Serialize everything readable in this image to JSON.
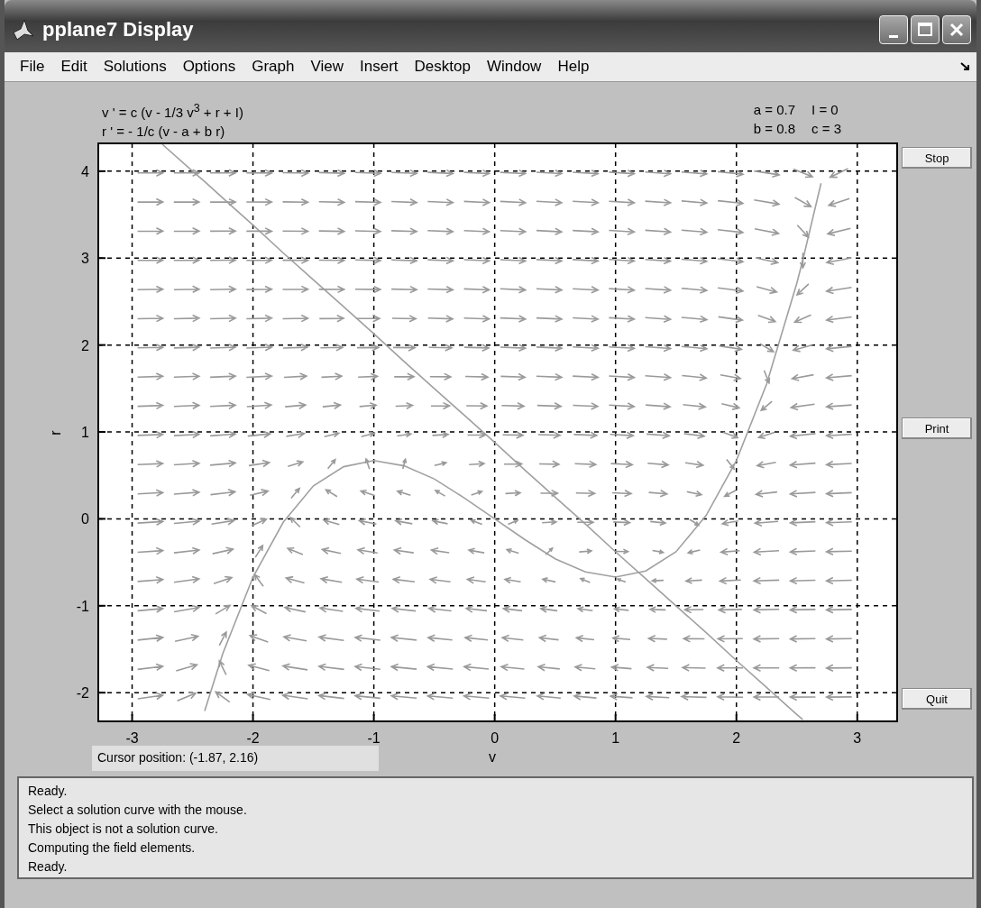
{
  "window": {
    "title": "pplane7 Display"
  },
  "menu": [
    "File",
    "Edit",
    "Solutions",
    "Options",
    "Graph",
    "View",
    "Insert",
    "Desktop",
    "Window",
    "Help"
  ],
  "equations": [
    "v ' = c (v - 1/3 v$^{3}$ + r + I)",
    "r ' = - 1/c (v - a + b r)"
  ],
  "parameters": [
    "a = 0.7",
    "I = 0",
    "b = 0.8",
    "c = 3"
  ],
  "plot": {
    "chart_data": {
      "type": "line",
      "xlabel": "v",
      "ylabel": "r",
      "x": [
        -2.75,
        -2.5,
        -2.4,
        -2.25,
        -2,
        -1.75,
        -1.5,
        -1.25,
        -1,
        -0.75,
        -0.5,
        -0.25,
        0,
        0.25,
        0.5,
        0.75,
        1,
        1.25,
        1.5,
        1.75,
        2,
        2.25,
        2.5,
        2.55,
        2.7
      ],
      "series": [
        {
          "color": "#a0a0a0",
          "values": [
            null,
            null,
            -2.21,
            -1.55,
            -0.67,
            -0.04,
            0.38,
            0.6,
            0.67,
            0.61,
            0.46,
            0.24,
            0,
            -0.24,
            -0.46,
            -0.61,
            -0.67,
            -0.6,
            -0.38,
            0.04,
            0.67,
            1.55,
            2.71,
            2.98,
            3.86
          ]
        },
        {
          "color": "#a0a0a0",
          "values": [
            4.31,
            4.0,
            3.88,
            3.69,
            3.38,
            3.06,
            2.75,
            2.44,
            2.13,
            1.81,
            1.5,
            1.19,
            0.88,
            0.56,
            0.25,
            -0.06,
            -0.38,
            -0.69,
            -1.0,
            -1.31,
            -1.63,
            -1.94,
            -2.25,
            -2.31,
            null
          ]
        }
      ],
      "grid": true,
      "xlim": [
        -3.28,
        3.33
      ],
      "ylim": [
        -2.33,
        4.32
      ],
      "xticks": [
        -3,
        -2,
        -1,
        0,
        1,
        2,
        3
      ],
      "yticks": [
        -2,
        -1,
        0,
        1,
        2,
        3,
        4
      ]
    }
  },
  "buttons": [
    "Stop",
    "Print",
    "Quit"
  ],
  "cursor_position": "Cursor position:  (-1.87, 2.16)",
  "messages": [
    "Ready.",
    "Select a solution curve with the mouse.",
    "This object is not a solution curve.",
    "Computing the field elements.",
    "Ready."
  ]
}
